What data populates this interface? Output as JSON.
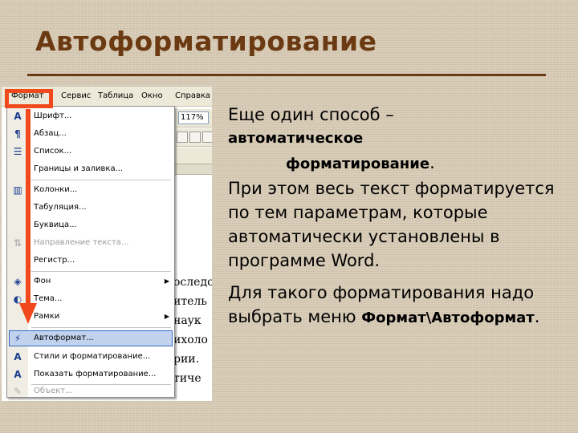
{
  "slide": {
    "title": "Автоформатирование",
    "accent_color": "#6b3a12",
    "highlight_color": "#f04a1c"
  },
  "menubar": {
    "items": [
      {
        "label": "Формат",
        "active": true
      },
      {
        "label": "Сервис"
      },
      {
        "label": "Таблица"
      },
      {
        "label": "Окно"
      },
      {
        "label": "Справка"
      }
    ]
  },
  "toolbar": {
    "zoom": "117%"
  },
  "format_menu": {
    "items": [
      {
        "label": "Шрифт...",
        "icon": "font-icon",
        "glyph": "A"
      },
      {
        "label": "Абзац...",
        "icon": "paragraph-icon",
        "glyph": "¶"
      },
      {
        "label": "Список...",
        "icon": "list-icon",
        "glyph": "☰"
      },
      {
        "label": "Границы и заливка...",
        "icon": "",
        "glyph": ""
      },
      {
        "label": "Колонки...",
        "icon": "columns-icon",
        "glyph": "▥"
      },
      {
        "label": "Табуляция...",
        "icon": "",
        "glyph": ""
      },
      {
        "label": "Буквица...",
        "icon": "",
        "glyph": ""
      },
      {
        "label": "Направление текста...",
        "icon": "text-direction-icon",
        "glyph": "⇅",
        "disabled": true
      },
      {
        "label": "Регистр...",
        "icon": "",
        "glyph": ""
      },
      {
        "label": "Фон",
        "icon": "background-icon",
        "glyph": "◈",
        "submenu": true
      },
      {
        "label": "Тема...",
        "icon": "theme-icon",
        "glyph": "◐"
      },
      {
        "label": "Рамки",
        "icon": "",
        "glyph": "",
        "submenu": true
      },
      {
        "label": "Автоформат...",
        "icon": "autoformat-icon",
        "glyph": "⚡",
        "highlighted": true
      },
      {
        "label": "Стили и форматирование...",
        "icon": "styles-icon",
        "glyph": "A"
      },
      {
        "label": "Показать форматирование...",
        "icon": "reveal-formatting-icon",
        "glyph": "A"
      },
      {
        "label": "Объект...",
        "icon": "object-icon",
        "glyph": "✎",
        "disabled": true
      }
    ]
  },
  "document_snippets": [
    "оследо",
    "итель",
    "наук",
    "ихоло",
    "рии.",
    "тиче"
  ],
  "text": {
    "line1": "Еще один способ –",
    "bold1": "автоматическое",
    "bold2": "форматирование",
    "period": ".",
    "para1": "При этом весь текст форматируется по тем параметрам, которые автоматически установлены в программе Word.",
    "para2": "Для такого форматирования надо выбрать меню",
    "bold3": "Формат\\Автоформат",
    "period2": "."
  }
}
